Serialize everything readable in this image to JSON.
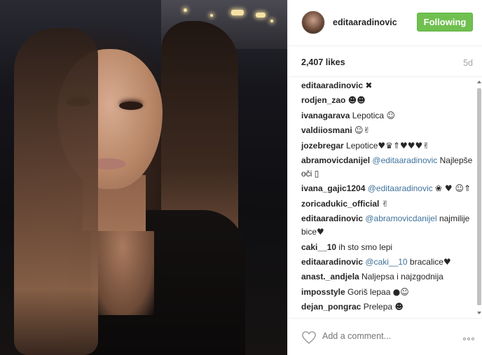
{
  "post": {
    "username": "editaaradinovic",
    "follow_label": "Following",
    "likes": "2,407 likes",
    "time": "5d"
  },
  "comments": [
    {
      "user": "editaaradinovic",
      "parts": [
        {
          "t": " "
        },
        {
          "t": "✖",
          "e": true
        }
      ]
    },
    {
      "user": "rodjen_zao",
      "parts": [
        {
          "t": " "
        },
        {
          "t": "☻☻",
          "e": true
        }
      ]
    },
    {
      "user": "ivanagarava",
      "parts": [
        {
          "t": " Lepotica "
        },
        {
          "t": "☺",
          "e": true
        }
      ]
    },
    {
      "user": "valdiiosmani",
      "parts": [
        {
          "t": " "
        },
        {
          "t": "☺✌",
          "e": true
        }
      ]
    },
    {
      "user": "jozebregar",
      "parts": [
        {
          "t": " Lepotice"
        },
        {
          "t": "♥♛⇑♥♥♥✌",
          "e": true
        }
      ]
    },
    {
      "user": "abramovicdanijel",
      "parts": [
        {
          "t": " "
        },
        {
          "t": "@editaaradinovic",
          "m": true
        },
        {
          "t": " Najlepše oči "
        },
        {
          "t": "▯",
          "e": true
        }
      ]
    },
    {
      "user": "ivana_gajic1204",
      "parts": [
        {
          "t": " "
        },
        {
          "t": "@editaaradinovic",
          "m": true
        },
        {
          "t": " "
        },
        {
          "t": "❀ ♥ ☺⇑",
          "e": true
        }
      ]
    },
    {
      "user": "zoricadukic_official",
      "parts": [
        {
          "t": " "
        },
        {
          "t": "✌",
          "e": true
        }
      ]
    },
    {
      "user": "editaaradinovic",
      "parts": [
        {
          "t": " "
        },
        {
          "t": "@abramovicdanijel",
          "m": true
        },
        {
          "t": " najmilije bice"
        },
        {
          "t": "♥",
          "e": true
        }
      ]
    },
    {
      "user": "caki__10",
      "parts": [
        {
          "t": " ih sto smo lepi"
        }
      ]
    },
    {
      "user": "editaaradinovic",
      "parts": [
        {
          "t": " "
        },
        {
          "t": "@caki__10",
          "m": true
        },
        {
          "t": " bracalice"
        },
        {
          "t": "♥",
          "e": true
        }
      ]
    },
    {
      "user": "anast._andjela",
      "parts": [
        {
          "t": " Naljepsa i najzgodnija"
        }
      ]
    },
    {
      "user": "imposstyle",
      "parts": [
        {
          "t": " Goriš lepaa "
        },
        {
          "t": "●☺",
          "e": true
        }
      ]
    },
    {
      "user": "dejan_pongrac",
      "parts": [
        {
          "t": " Prelepa "
        },
        {
          "t": "☻",
          "e": true
        }
      ]
    }
  ],
  "footer": {
    "add_comment_placeholder": "Add a comment...",
    "heart_icon": "heart-outline-icon",
    "more_icon": "more-options-icon"
  }
}
